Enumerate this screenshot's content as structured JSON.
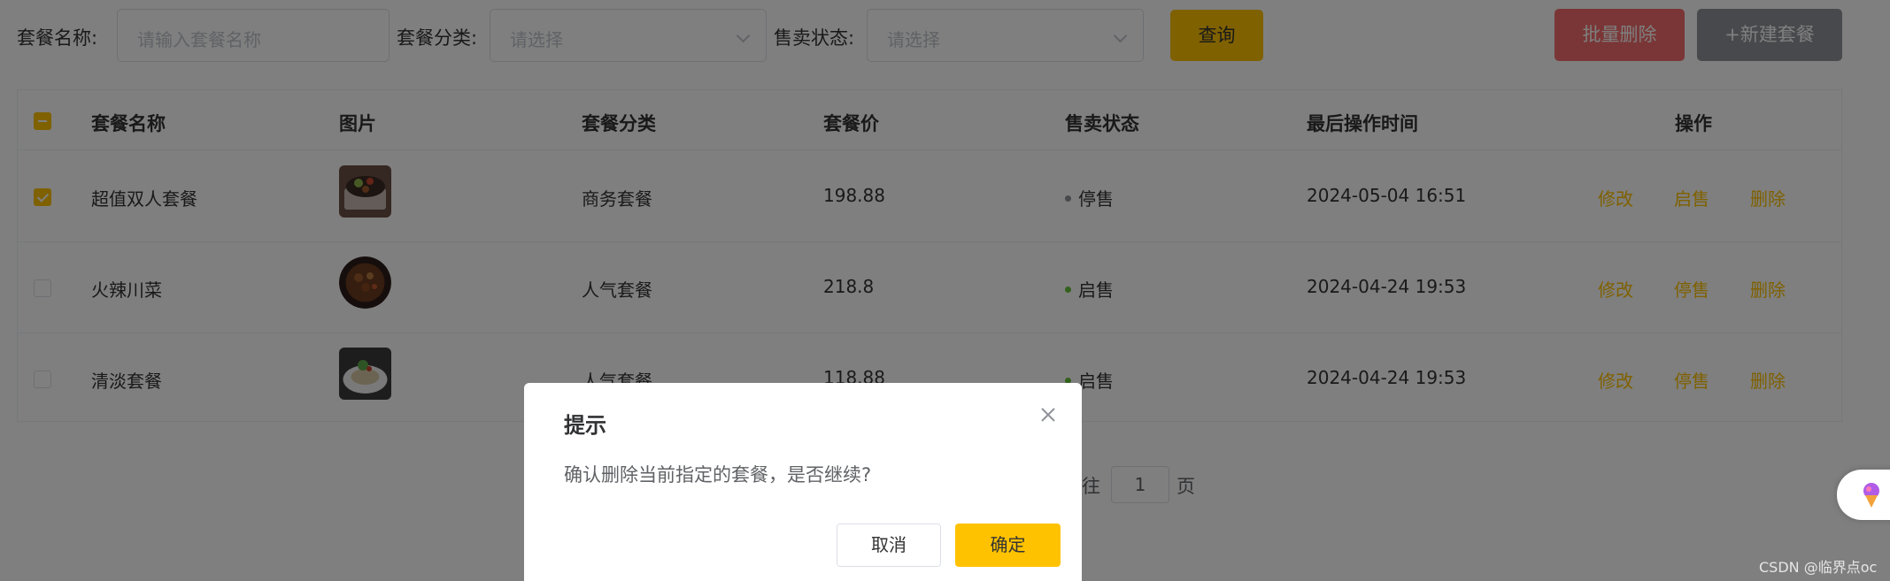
{
  "filters": {
    "name_label": "套餐名称:",
    "name_placeholder": "请输入套餐名称",
    "category_label": "套餐分类:",
    "category_placeholder": "请选择",
    "status_label": "售卖状态:",
    "status_placeholder": "请选择",
    "query_button": "查询"
  },
  "actions": {
    "batch_delete": "批量删除",
    "new_setmeal": "+新建套餐"
  },
  "table": {
    "headers": {
      "name": "套餐名称",
      "image": "图片",
      "category": "套餐分类",
      "price": "套餐价",
      "status": "售卖状态",
      "updated": "最后操作时间",
      "ops": "操作"
    },
    "rows": [
      {
        "checked": true,
        "name": "超值双人套餐",
        "category": "商务套餐",
        "price": "198.88",
        "status": "停售",
        "status_color": "#909399",
        "updated": "2024-05-04 16:51",
        "op_edit": "修改",
        "op_toggle": "启售",
        "op_delete": "删除"
      },
      {
        "checked": false,
        "name": "火辣川菜",
        "category": "人气套餐",
        "price": "218.8",
        "status": "启售",
        "status_color": "#67c23a",
        "updated": "2024-04-24 19:53",
        "op_edit": "修改",
        "op_toggle": "停售",
        "op_delete": "删除"
      },
      {
        "checked": false,
        "name": "清淡套餐",
        "category": "人气套餐",
        "price": "118.88",
        "status": "启售",
        "status_color": "#67c23a",
        "updated": "2024-04-24 19:53",
        "op_edit": "修改",
        "op_toggle": "停售",
        "op_delete": "删除"
      }
    ]
  },
  "pagination": {
    "goto_suffix": "往",
    "page_value": "1",
    "page_unit": "页"
  },
  "dialog": {
    "title": "提示",
    "message": "确认删除当前指定的套餐，是否继续?",
    "cancel": "取消",
    "confirm": "确定"
  },
  "watermark": "CSDN @临界点oc",
  "colors": {
    "accent": "#ffc200",
    "danger": "#f56c6c",
    "neutral": "#909399",
    "on_sale": "#67c23a",
    "off_sale": "#909399"
  }
}
